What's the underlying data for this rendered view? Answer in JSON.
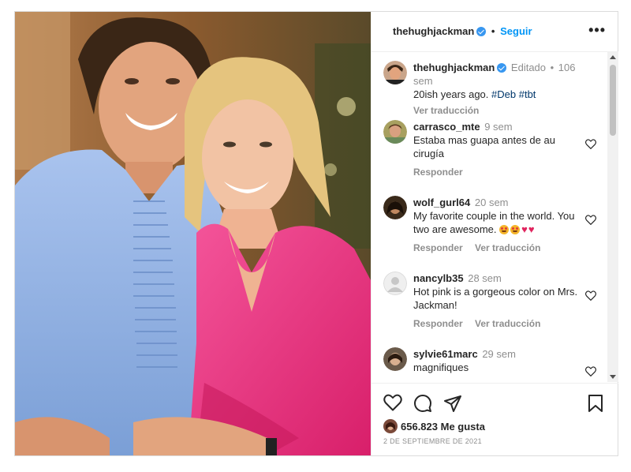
{
  "header": {
    "username": "thehughjackman",
    "separator": "•",
    "follow_label": "Seguir",
    "more_label": "•••"
  },
  "caption": {
    "username": "thehughjackman",
    "edited": "Editado",
    "age": "106 sem",
    "text": "20ish years ago.",
    "hashtags": "#Deb #tbt",
    "translate_label": "Ver traducción"
  },
  "comments": [
    {
      "username": "carrasco_mte",
      "age": "9 sem",
      "text": "Estaba mas guapa antes de au cirugía",
      "reply_label": "Responder",
      "translate_label": ""
    },
    {
      "username": "wolf_gurl64",
      "age": "20 sem",
      "text": "My favorite couple in the world. You two are awesome.",
      "reply_label": "Responder",
      "translate_label": "Ver traducción"
    },
    {
      "username": "nancylb35",
      "age": "28 sem",
      "text": "Hot pink is a gorgeous color on Mrs. Jackman!",
      "reply_label": "Responder",
      "translate_label": "Ver traducción"
    },
    {
      "username": "sylvie61marc",
      "age": "29 sem",
      "text": "magnifiques",
      "reply_label": "",
      "translate_label": ""
    }
  ],
  "likes": {
    "count": "656.823",
    "label": "Me gusta"
  },
  "date": "2 DE SEPTIEMBRE DE 2021",
  "icons": {
    "like": "heart-icon",
    "comment": "comment-icon",
    "share": "send-icon",
    "save": "bookmark-icon",
    "verified": "verified-badge-icon"
  },
  "colors": {
    "accent": "#0095f6",
    "verified": "#3897f0",
    "shirt_blue": "#8fb2e6",
    "shirt_pink": "#e8397a"
  }
}
